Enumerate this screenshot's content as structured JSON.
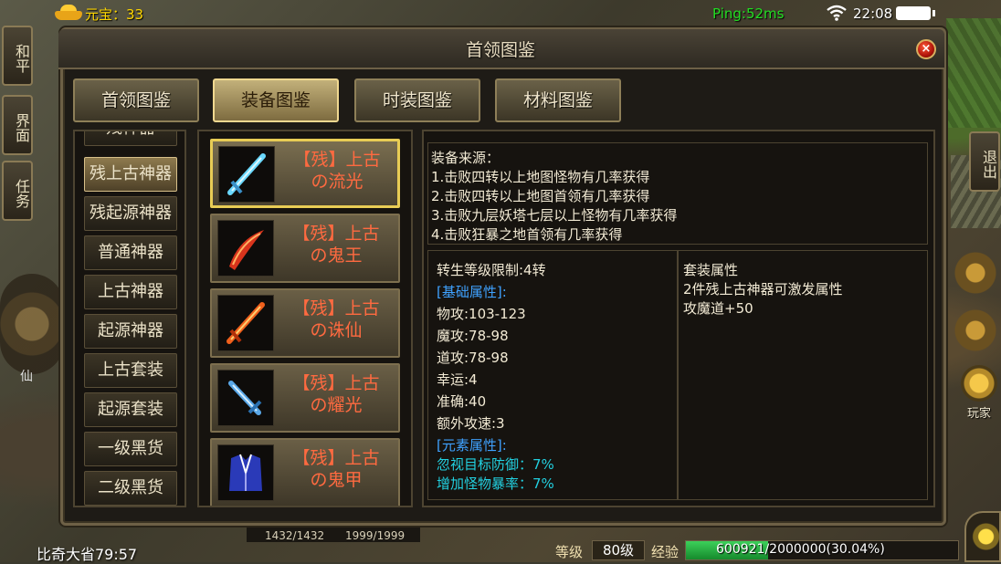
{
  "status": {
    "currency_label": "元宝：33",
    "ping": "Ping:52ms",
    "time": "22:08"
  },
  "side_buttons": {
    "peace": "和平",
    "interface": "界面",
    "quest": "任务",
    "exit": "退出",
    "player": "玩家",
    "sword_prop": "仙"
  },
  "panel": {
    "title": "首领图鉴",
    "close_glyph": "×"
  },
  "tabs": [
    {
      "label": "首领图鉴",
      "active": false
    },
    {
      "label": "装备图鉴",
      "active": true
    },
    {
      "label": "时装图鉴",
      "active": false
    },
    {
      "label": "材料图鉴",
      "active": false
    }
  ],
  "categories": [
    {
      "label": "残神器",
      "active": false
    },
    {
      "label": "残上古神器",
      "active": true
    },
    {
      "label": "残起源神器",
      "active": false
    },
    {
      "label": "普通神器",
      "active": false
    },
    {
      "label": "上古神器",
      "active": false
    },
    {
      "label": "起源神器",
      "active": false
    },
    {
      "label": "上古套装",
      "active": false
    },
    {
      "label": "起源套装",
      "active": false
    },
    {
      "label": "一级黑货",
      "active": false
    },
    {
      "label": "二级黑货",
      "active": false
    }
  ],
  "equipment": [
    {
      "line1": "【残】上古",
      "line2": "の流光",
      "icon": "blue-sword-icon",
      "active": true
    },
    {
      "line1": "【残】上古",
      "line2": "の鬼王",
      "icon": "red-blade-icon",
      "active": false
    },
    {
      "line1": "【残】上古",
      "line2": "の诛仙",
      "icon": "fire-sword-icon",
      "active": false
    },
    {
      "line1": "【残】上古",
      "line2": "の耀光",
      "icon": "ice-sword-icon",
      "active": false
    },
    {
      "line1": "【残】上古",
      "line2": "の鬼甲",
      "icon": "blue-armor-icon",
      "active": false
    }
  ],
  "source": {
    "title": "装备来源：",
    "lines": [
      "1.击败四转以上地图怪物有几率获得",
      "2.击败四转以上地图首领有几率获得",
      "3.击败九层妖塔七层以上怪物有几率获得",
      "4.击败狂暴之地首领有几率获得"
    ]
  },
  "attributes": {
    "requirement": "转生等级限制:4转",
    "base_header": "[基础属性]:",
    "base": [
      "物攻:103-123",
      "魔攻:78-98",
      "道攻:78-98",
      "幸运:4",
      "准确:40",
      "额外攻速:3"
    ],
    "element_header": "[元素属性]:",
    "element": [
      "忽视目标防御：7%",
      "增加怪物暴率：7%"
    ]
  },
  "set": {
    "title": "套装属性",
    "lines": [
      "2件残上古神器可激发属性",
      "攻魔道+50"
    ]
  },
  "hud": {
    "hp": "1432/1432",
    "mp": "1999/1999",
    "location": "比奇大省79:57",
    "level_label": "等级",
    "level": "80级",
    "exp_label": "经验",
    "exp_text": "600921/2000000(30.04%)",
    "exp_fraction": 0.3004
  },
  "colors": {
    "ping": "#22dd22",
    "currency": "#ffd700",
    "equip_name": "#ff6a40",
    "attr_header": "#3fa2ff",
    "element_attr": "#22d0e0",
    "active_border": "#e8cc55"
  }
}
